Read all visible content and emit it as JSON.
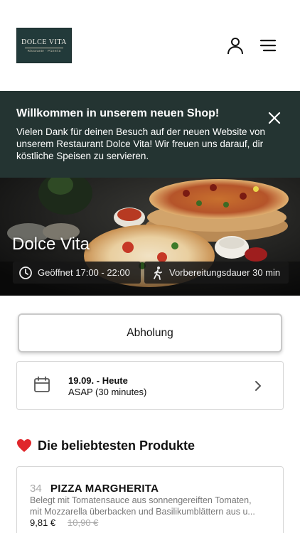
{
  "header": {
    "logo": {
      "name": "DOLCE VITA",
      "tagline": "Ristorante · Pizzeria"
    },
    "icons": {
      "account": "user-icon",
      "menu": "hamburger-menu-icon"
    }
  },
  "banner": {
    "title": "Willkommen in unserem neuen Shop!",
    "text": "Vielen Dank für deinen Besuch auf der neuen Website von unserem Restaurant Dolce Vita! Wir freuen uns darauf, dir köstliche Speisen zu servieren.",
    "close_icon": "close-icon",
    "background": "#243432"
  },
  "hero": {
    "restaurant_name": "Dolce Vita",
    "opening_hours": "Geöffnet 17:00 - 22:00",
    "preparation_time": "Vorbereitungsdauer 30 min"
  },
  "order_mode": {
    "selected": "Abholung"
  },
  "schedule": {
    "date_label": "19.09. - Heute",
    "time_label": "ASAP (30 minutes)"
  },
  "popular": {
    "title": "Die beliebtesten Produkte",
    "products": [
      {
        "number": "34",
        "name": "PIZZA MARGHERITA",
        "description_line1": "Belegt mit Tomatensauce aus sonnengereiften Tomaten,",
        "description_line2": "mit Mozzarella überbacken und Basilikumblättern aus u...",
        "price": "9,81 €",
        "old_price": "10,90 €"
      }
    ]
  }
}
